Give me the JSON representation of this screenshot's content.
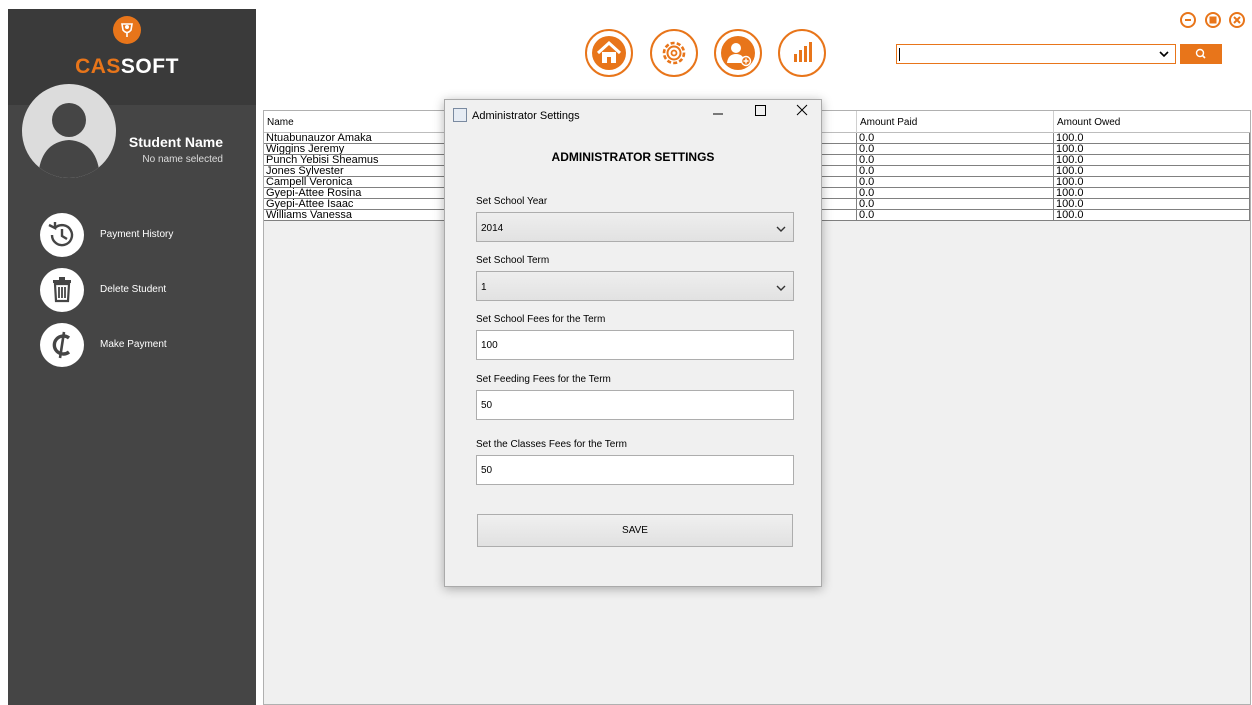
{
  "brand": {
    "prefix": "CAS",
    "suffix": "SOFT",
    "accent_color": "#e8751a"
  },
  "sidebar": {
    "student_name": "Student Name",
    "student_subtitle": "No name selected",
    "items": [
      {
        "label": "Payment History",
        "icon": "history-icon"
      },
      {
        "label": "Delete Student",
        "icon": "trash-icon"
      },
      {
        "label": "Make Payment",
        "icon": "cedi-icon"
      }
    ]
  },
  "toolbar": {
    "icons": [
      "home-icon",
      "gear-icon",
      "add-user-icon",
      "bar-chart-icon"
    ]
  },
  "window_controls": [
    "minimize-icon",
    "maximize-icon",
    "close-icon"
  ],
  "search": {
    "value": "",
    "icon": "search-icon"
  },
  "table": {
    "columns": [
      "Name",
      "Amount Paid",
      "Amount Owed"
    ],
    "rows": [
      [
        "Ntuabunauzor Amaka",
        "0.0",
        "100.0"
      ],
      [
        "Wiggins Jeremy",
        "0.0",
        "100.0"
      ],
      [
        "Punch Yebisi Sheamus",
        "0.0",
        "100.0"
      ],
      [
        "Jones Sylvester",
        "0.0",
        "100.0"
      ],
      [
        "Campell  Veronica",
        "0.0",
        "100.0"
      ],
      [
        "Gyepi-Attee  Rosina",
        "0.0",
        "100.0"
      ],
      [
        "Gyepi-Attee Isaac",
        "0.0",
        "100.0"
      ],
      [
        "Williams Vanessa",
        "0.0",
        "100.0"
      ]
    ]
  },
  "dialog": {
    "title": "Administrator Settings",
    "heading": "ADMINISTRATOR SETTINGS",
    "fields": {
      "school_year": {
        "label": "Set School Year",
        "value": "2014"
      },
      "school_term": {
        "label": "Set School Term",
        "value": "1"
      },
      "school_fees": {
        "label": "Set School Fees for the Term",
        "value": "100"
      },
      "feeding_fees": {
        "label": "Set Feeding Fees for the Term",
        "value": "50"
      },
      "classes_fees": {
        "label": "Set the Classes Fees for the Term",
        "value": "50"
      }
    },
    "save_label": "SAVE"
  }
}
